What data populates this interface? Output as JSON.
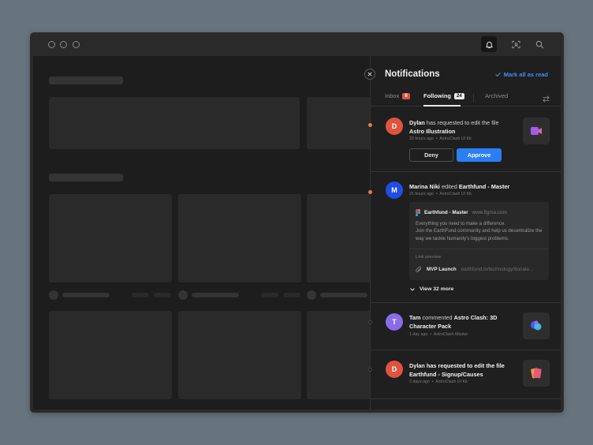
{
  "window": {
    "tab_icons": [
      "bell-icon",
      "scan-icon",
      "search-icon"
    ]
  },
  "panel": {
    "title": "Notifications",
    "mark_all_read": "Mark all as read",
    "tabs": [
      {
        "label": "Inbox",
        "badge": "8"
      },
      {
        "label": "Following",
        "badge": "24"
      },
      {
        "label": "Archived",
        "badge": ""
      }
    ],
    "active_tab": "Following"
  },
  "notifications": [
    {
      "avatar_letter": "D",
      "avatar_color": "#e0533f",
      "user": "Dylan",
      "action": " has requested to edit the file ",
      "target": "Astro Illustration",
      "time": "20 hours ago",
      "source": "AstroClash UI Kit",
      "unread": true,
      "deny_label": "Deny",
      "approve_label": "Approve",
      "thumb_icon": "video-camera-icon"
    },
    {
      "avatar_letter": "M",
      "avatar_color": "#1f4de6",
      "user": "Marina Niki",
      "action": " edited ",
      "target": "Earthfund - Master",
      "time": "21 hours ago",
      "source": "AstroClash UI Kit",
      "unread": true,
      "card": {
        "title": "Earthfund - Master",
        "url": "www.figma.com",
        "body": "Everything you need to make a difference.\nJoin the EarthFund community and help us decentralize the way we tackle humanity's biggest problems.",
        "preview_label": "Link preview",
        "link_name": "MVP Launch",
        "link_url": "earthfund.io/technology/donate..."
      },
      "view_more": "View 32 more"
    },
    {
      "avatar_letter": "T",
      "avatar_color": "#8a6be8",
      "user": "Tam",
      "action": " commented ",
      "target": "Astro Clash: 3D Character Pack",
      "time": "1 day ago",
      "source": "AstroClash Master",
      "unread": false,
      "thumb_icon": "3d-shapes-icon"
    },
    {
      "avatar_letter": "D",
      "avatar_color": "#e0533f",
      "user": "Dylan",
      "action": " has requested to edit the file ",
      "target": "Earthfund - Signup/Causes",
      "time": "2 days ago",
      "source": "AstroClash UI Kit",
      "unread": false,
      "thumb_icon": "cards-stack-icon"
    }
  ],
  "colors": {
    "accent": "#2a7ff5",
    "unread_dot": "#e67a4b",
    "badge_red": "#e0533f"
  }
}
